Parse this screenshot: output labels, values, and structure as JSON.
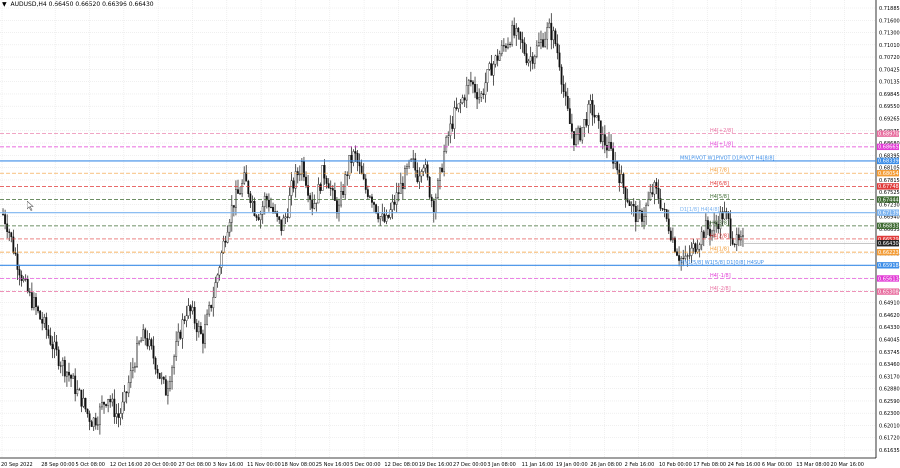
{
  "window": {
    "title": "AUDUSD,H4  0.66450 0.66520 0.66396 0.66430",
    "menu_icon": "triangle-down-icon",
    "cursor_icon": "arrow-cursor-icon"
  },
  "colors": {
    "background": "#ffffff",
    "grid": "#e6e6e6",
    "candle": "#111111",
    "axis_text": "#000000",
    "blue_level": "#3d8ee8",
    "light_blue_level": "#7db4f0",
    "orange_level": "#f39c36",
    "red_level": "#e03a3a",
    "magenta_level": "#e23cd6",
    "pink_level": "#e86fa0",
    "dark_green_level": "#3f6b33"
  },
  "chart_data": {
    "type": "candlestick",
    "symbol": "AUDUSD",
    "timeframe": "H4",
    "ohlc_header": {
      "open": 0.6645,
      "high": 0.6652,
      "low": 0.66396,
      "close": 0.6643
    },
    "ylim": [
      0.61635,
      0.71885
    ],
    "y_ticks": [
      "0.71885",
      "0.71600",
      "0.71300",
      "0.71010",
      "0.70720",
      "0.70425",
      "0.70135",
      "0.69845",
      "0.69550",
      "0.69265",
      "0.68975",
      "0.68680",
      "0.68395",
      "0.68105",
      "0.67815",
      "0.67525",
      "0.67230",
      "0.66940",
      "0.66655",
      "0.66365",
      "0.66075",
      "0.65785",
      "0.65495",
      "0.65200",
      "0.64910",
      "0.64620",
      "0.64330",
      "0.64045",
      "0.63745",
      "0.63460",
      "0.63170",
      "0.62880",
      "0.62590",
      "0.62300",
      "0.62010",
      "0.61720",
      "0.61635"
    ],
    "x_ticks": [
      "20 Sep 2022",
      "28 Sep 00:00",
      "5 Oct 08:00",
      "12 Oct 16:00",
      "20 Oct 00:00",
      "27 Oct 08:00",
      "3 Nov 16:00",
      "11 Nov 00:00",
      "18 Nov 08:00",
      "25 Nov 16:00",
      "5 Dec 00:00",
      "12 Dec 08:00",
      "19 Dec 16:00",
      "27 Dec 00:00",
      "3 Jan 08:00",
      "11 Jan 16:00",
      "19 Jan 00:00",
      "26 Jan 08:00",
      "2 Feb 16:00",
      "10 Feb 00:00",
      "17 Feb 08:00",
      "24 Feb 16:00",
      "6 Mar 00:00",
      "13 Mar 08:00",
      "20 Mar 16:00"
    ],
    "price_path": [
      0.671,
      0.668,
      0.663,
      0.659,
      0.655,
      0.652,
      0.65,
      0.647,
      0.645,
      0.642,
      0.639,
      0.637,
      0.635,
      0.633,
      0.63,
      0.628,
      0.625,
      0.623,
      0.624,
      0.627,
      0.629,
      0.626,
      0.624,
      0.627,
      0.632,
      0.637,
      0.641,
      0.643,
      0.64,
      0.637,
      0.633,
      0.63,
      0.635,
      0.64,
      0.645,
      0.649,
      0.648,
      0.645,
      0.642,
      0.647,
      0.652,
      0.658,
      0.664,
      0.67,
      0.674,
      0.676,
      0.679,
      0.676,
      0.672,
      0.671,
      0.675,
      0.673,
      0.67,
      0.668,
      0.671,
      0.677,
      0.68,
      0.683,
      0.678,
      0.673,
      0.676,
      0.681,
      0.679,
      0.674,
      0.672,
      0.678,
      0.683,
      0.685,
      0.681,
      0.677,
      0.676,
      0.673,
      0.67,
      0.669,
      0.672,
      0.675,
      0.678,
      0.681,
      0.683,
      0.68,
      0.684,
      0.678,
      0.673,
      0.678,
      0.685,
      0.69,
      0.694,
      0.696,
      0.699,
      0.702,
      0.7,
      0.698,
      0.702,
      0.705,
      0.707,
      0.709,
      0.711,
      0.713,
      0.712,
      0.71,
      0.707,
      0.708,
      0.71,
      0.712,
      0.714,
      0.712,
      0.707,
      0.698,
      0.692,
      0.688,
      0.69,
      0.693,
      0.696,
      0.693,
      0.689,
      0.687,
      0.685,
      0.682,
      0.678,
      0.675,
      0.672,
      0.67,
      0.671,
      0.674,
      0.677,
      0.675,
      0.671,
      0.668,
      0.664,
      0.661,
      0.66,
      0.662,
      0.664,
      0.666,
      0.668,
      0.667,
      0.669,
      0.671,
      0.67,
      0.666,
      0.664,
      0.6643
    ],
    "levels": [
      {
        "label": "H4[+2/8]",
        "price_label": "0.68970",
        "price": 0.6897,
        "color_key": "pink_level",
        "style": "dash"
      },
      {
        "label": "H4[+1/8]",
        "price_label": "0.68665",
        "price": 0.68665,
        "color_key": "magenta_level",
        "style": "dash"
      },
      {
        "label": "MN1PIVOT W1PIVOT D1PIVOT H4[8/8]",
        "price_label": "0.68339",
        "price": 0.68339,
        "color_key": "blue_level",
        "style": "solid"
      },
      {
        "label": "H4[7/8]",
        "price_label": "0.68054",
        "price": 0.68054,
        "color_key": "orange_level",
        "style": "dash"
      },
      {
        "label": "H4[6/8]",
        "price_label": "0.67748",
        "price": 0.67748,
        "color_key": "red_level",
        "style": "dash"
      },
      {
        "label": "H4[5/8]",
        "price_label": "0.67444",
        "price": 0.67444,
        "color_key": "dark_green_level",
        "style": "dash"
      },
      {
        "label": "D1[1/8] H4[4/8]",
        "price_label": "0.67139",
        "price": 0.67139,
        "color_key": "light_blue_level",
        "style": "solid"
      },
      {
        "label": "H4[3/8]",
        "price_label": "0.66833",
        "price": 0.66833,
        "color_key": "dark_green_level",
        "style": "dash"
      },
      {
        "label": "H4[2/8]",
        "price_label": "0.66529",
        "price": 0.66529,
        "color_key": "red_level",
        "style": "dash"
      },
      {
        "label": "H4[1/8]",
        "price_label": "0.66223",
        "price": 0.66223,
        "color_key": "orange_level",
        "style": "dash"
      },
      {
        "label": "MN1[5/8] W1[5/8] D1[0/8] H4SUP",
        "price_label": "0.65918",
        "price": 0.65918,
        "color_key": "blue_level",
        "style": "solid"
      },
      {
        "label": "H4[-1/8]",
        "price_label": "0.65613",
        "price": 0.65613,
        "color_key": "magenta_level",
        "style": "dash"
      },
      {
        "label": "H4[-2/8]",
        "price_label": "0.65308",
        "price": 0.65308,
        "color_key": "pink_level",
        "style": "dash"
      }
    ],
    "current_price_label": "0.66430",
    "current_price": 0.6643,
    "grid": true
  }
}
